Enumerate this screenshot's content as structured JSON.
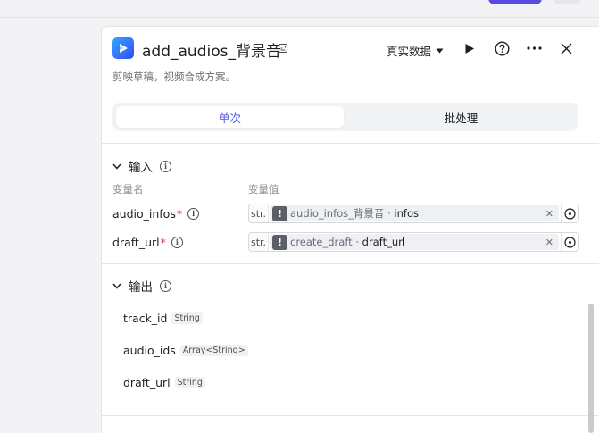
{
  "node": {
    "title": "add_audios_背景音",
    "description": "剪映草稿，视频合成方案。",
    "data_mode": "真实数据"
  },
  "tabs": [
    {
      "label": "单次",
      "active": true
    },
    {
      "label": "批处理",
      "active": false
    }
  ],
  "inputs": {
    "title": "输入",
    "col_name": "变量名",
    "col_value": "变量值",
    "params": [
      {
        "name": "audio_infos",
        "type": "str.",
        "ref_node": "audio_infos_背景音",
        "ref_field": "infos"
      },
      {
        "name": "draft_url",
        "type": "str.",
        "ref_node": "create_draft",
        "ref_field": "draft_url"
      }
    ]
  },
  "outputs": {
    "title": "输出",
    "items": [
      {
        "name": "track_id",
        "type": "String"
      },
      {
        "name": "audio_ids",
        "type": "Array<String>"
      },
      {
        "name": "draft_url",
        "type": "String"
      }
    ]
  },
  "colors": {
    "accent": "#4d53e8",
    "primary_button": "#5a4be8",
    "required": "#e0334c"
  },
  "icons": {
    "app": "capcut-logo-icon",
    "edit": "edit-icon",
    "run": "play-icon",
    "help": "help-icon",
    "more": "more-icon",
    "close": "close-icon"
  }
}
